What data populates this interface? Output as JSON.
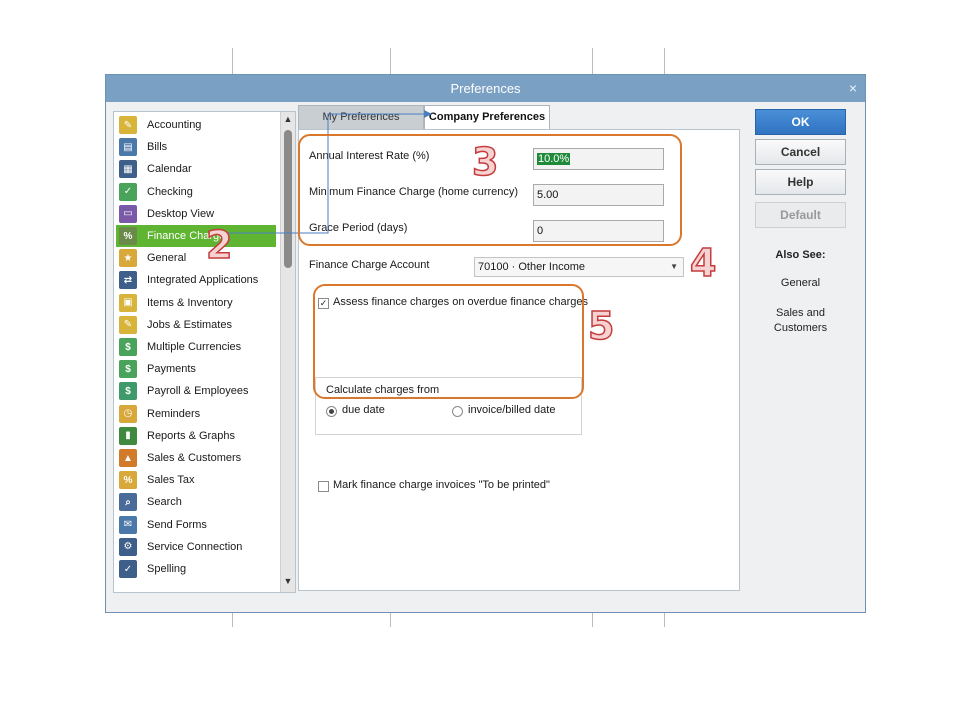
{
  "window": {
    "title": "Preferences",
    "close_glyph": "×"
  },
  "sidebar": {
    "items": [
      {
        "label": "Accounting",
        "icon": "accounting-icon",
        "color": "#d8b43a"
      },
      {
        "label": "Bills",
        "icon": "bills-icon",
        "color": "#4a78a8"
      },
      {
        "label": "Calendar",
        "icon": "calendar-icon",
        "color": "#3e5f8a"
      },
      {
        "label": "Checking",
        "icon": "checking-icon",
        "color": "#4aa35a"
      },
      {
        "label": "Desktop View",
        "icon": "desktop-view-icon",
        "color": "#7a5aa8"
      },
      {
        "label": "Finance Charge",
        "icon": "percent-icon",
        "color": "#6a8a4a"
      },
      {
        "label": "General",
        "icon": "general-icon",
        "color": "#d8a83a"
      },
      {
        "label": "Integrated Applications",
        "icon": "integrated-apps-icon",
        "color": "#3e5f8a"
      },
      {
        "label": "Items & Inventory",
        "icon": "inventory-icon",
        "color": "#d8b43a"
      },
      {
        "label": "Jobs & Estimates",
        "icon": "jobs-icon",
        "color": "#d8b43a"
      },
      {
        "label": "Multiple Currencies",
        "icon": "currencies-icon",
        "color": "#4aa35a"
      },
      {
        "label": "Payments",
        "icon": "payments-icon",
        "color": "#4aa35a"
      },
      {
        "label": "Payroll & Employees",
        "icon": "payroll-icon",
        "color": "#3f9a6a"
      },
      {
        "label": "Reminders",
        "icon": "alarm-clock-icon",
        "color": "#d8a83a"
      },
      {
        "label": "Reports & Graphs",
        "icon": "bar-chart-icon",
        "color": "#3f8a3f"
      },
      {
        "label": "Sales & Customers",
        "icon": "sales-icon",
        "color": "#d07a2a"
      },
      {
        "label": "Sales Tax",
        "icon": "sales-tax-icon",
        "color": "#d8a83a"
      },
      {
        "label": "Search",
        "icon": "magnifier-icon",
        "color": "#4a6a9a"
      },
      {
        "label": "Send Forms",
        "icon": "send-forms-icon",
        "color": "#4a78a8"
      },
      {
        "label": "Service Connection",
        "icon": "service-connection-icon",
        "color": "#3e5f8a"
      },
      {
        "label": "Spelling",
        "icon": "spelling-icon",
        "color": "#3e5f8a"
      }
    ],
    "selected_index": 5
  },
  "tabs": {
    "my": "My Preferences",
    "company": "Company Preferences"
  },
  "form": {
    "interest_label": "Annual Interest Rate (%)",
    "interest_value": "10.0%",
    "min_charge_label": "Minimum Finance Charge (home currency)",
    "min_charge_value": "5.00",
    "grace_label": "Grace Period (days)",
    "grace_value": "0",
    "account_label": "Finance Charge Account",
    "account_value": "70100 · Other Income",
    "assess_label": "Assess finance charges on overdue finance charges",
    "assess_checked": true,
    "calc_label": "Calculate charges from",
    "radio_due": "due date",
    "radio_invoice": "invoice/billed date",
    "mark_label": "Mark finance charge invoices \"To be printed\"",
    "mark_checked": false
  },
  "buttons": {
    "ok": "OK",
    "cancel": "Cancel",
    "help": "Help",
    "default": "Default"
  },
  "also_see": {
    "heading": "Also See:",
    "link1": "General",
    "link2": "Sales and Customers"
  },
  "annotations": {
    "n2": "2",
    "n3": "3",
    "n4": "4",
    "n5": "5",
    "color": "#d9782d"
  }
}
